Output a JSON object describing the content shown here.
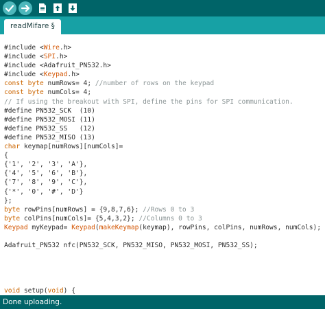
{
  "toolbar": {
    "buttons": [
      {
        "name": "verify",
        "icon": "check-icon"
      },
      {
        "name": "upload",
        "icon": "arrow-right-icon"
      },
      {
        "name": "new",
        "icon": "new-file-icon"
      },
      {
        "name": "open",
        "icon": "open-arrow-up-icon"
      },
      {
        "name": "save",
        "icon": "save-arrow-down-icon"
      }
    ]
  },
  "tabs": [
    {
      "label": "readMifare §"
    }
  ],
  "code": {
    "lines": [
      "#include <Wire.h>",
      "#include <SPI.h>",
      "#include <Adafruit_PN532.h>",
      "#include <Keypad.h>",
      "const byte numRows= 4; //number of rows on the keypad",
      "const byte numCols= 4;",
      "// If using the breakout with SPI, define the pins for SPI communication.",
      "#define PN532_SCK  (10)",
      "#define PN532_MOSI (11)",
      "#define PN532_SS   (12)",
      "#define PN532_MISO (13)",
      "char keymap[numRows][numCols]=",
      "{",
      "{'1', '2', '3', 'A'},",
      "{'4', '5', '6', 'B'},",
      "{'7', '8', '9', 'C'},",
      "{'*', '0', '#', 'D'}",
      "};",
      "byte rowPins[numRows] = {9,8,7,6}; //Rows 0 to 3",
      "byte colPins[numCols]= {5,4,3,2}; //Columns 0 to 3",
      "Keypad myKeypad= Keypad(makeKeymap(keymap), rowPins, colPins, numRows, numCols);",
      "",
      "Adafruit_PN532 nfc(PN532_SCK, PN532_MISO, PN532_MOSI, PN532_SS);",
      "",
      "",
      "",
      "",
      "void setup(void) {"
    ]
  },
  "status": {
    "message": "Done uploading."
  },
  "colors": {
    "toolbar": "#006468",
    "tabbar": "#17a1a5",
    "keyword": "#cc6600",
    "comment": "#8a9495",
    "type": "#00979d"
  }
}
